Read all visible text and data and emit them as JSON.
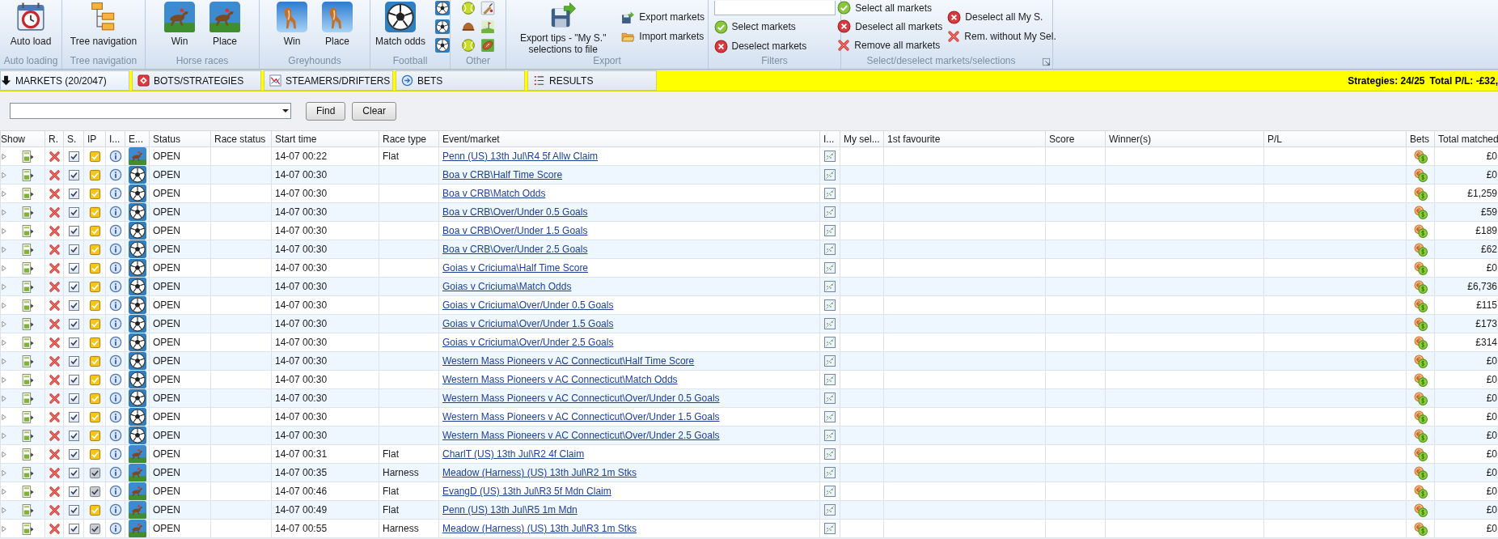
{
  "ribbon": {
    "groups": [
      {
        "label": "Auto loading",
        "buttons": [
          {
            "kind": "large",
            "label": "Auto load"
          }
        ]
      },
      {
        "label": "Tree navigation",
        "buttons": [
          {
            "kind": "large",
            "label": "Tree navigation"
          }
        ]
      },
      {
        "label": "Horse races",
        "buttons": [
          {
            "kind": "large",
            "label": "Win"
          },
          {
            "kind": "large",
            "label": "Place"
          }
        ]
      },
      {
        "label": "Greyhounds",
        "buttons": [
          {
            "kind": "large",
            "label": "Win"
          },
          {
            "kind": "large",
            "label": "Place"
          }
        ]
      },
      {
        "label": "Football",
        "buttons": [
          {
            "kind": "large",
            "label": "Match odds"
          },
          {
            "kind": "icon"
          },
          {
            "kind": "icon"
          },
          {
            "kind": "icon"
          }
        ]
      },
      {
        "label": "Other",
        "buttons": [
          {
            "kind": "icon"
          },
          {
            "kind": "icon"
          },
          {
            "kind": "icon"
          },
          {
            "kind": "icon"
          },
          {
            "kind": "icon"
          },
          {
            "kind": "icon"
          }
        ]
      },
      {
        "label": "Export",
        "buttons": [
          {
            "kind": "large",
            "label": "Export tips - \"My S.\" selections to file"
          },
          {
            "kind": "small",
            "label": "Export markets"
          },
          {
            "kind": "small",
            "label": "Import markets"
          }
        ]
      },
      {
        "label": "Filters",
        "buttons": [
          {
            "kind": "field"
          },
          {
            "kind": "small",
            "label": "Select markets"
          },
          {
            "kind": "small",
            "label": "Deselect markets"
          }
        ]
      },
      {
        "label": "Select/deselect markets/selections",
        "launcher": true,
        "buttons": [
          {
            "kind": "small",
            "label": "Select all markets"
          },
          {
            "kind": "small",
            "label": "Deselect all markets"
          },
          {
            "kind": "small",
            "label": "Remove all markets"
          },
          {
            "kind": "small",
            "label": "Deselect all My S."
          },
          {
            "kind": "small",
            "label": "Rem. without My Sel."
          }
        ]
      }
    ]
  },
  "tabs": [
    {
      "label": "MARKETS (20/2047)",
      "selected": true
    },
    {
      "label": "BOTS/STRATEGIES",
      "selected": false
    },
    {
      "label": "STEAMERS/DRIFTERS",
      "selected": false
    },
    {
      "label": "BETS",
      "selected": false
    },
    {
      "label": "RESULTS",
      "selected": false
    }
  ],
  "status_bar": {
    "strategies": "Strategies: 24/25",
    "total_pl": "Total P/L: -£32,"
  },
  "find_bar": {
    "buttons": [
      "Find",
      "Clear"
    ]
  },
  "table": {
    "columns": [
      "Show",
      "R.",
      "S.",
      "IP",
      "I...",
      "E...",
      "Status",
      "Race status",
      "Start time",
      "Race type",
      "Event/market",
      "I...",
      "My sel...",
      "1st favourite",
      "Score",
      "Winner(s)",
      "P/L",
      "Bets",
      "Total matched"
    ],
    "rows": [
      {
        "kind": "horse",
        "checked": true,
        "in_play": true,
        "status": "OPEN",
        "start_time": "14-07 00:22",
        "race_type": "Flat",
        "event": "Penn (US) 13th Jul\\R4 5f Allw Claim",
        "total_matched": "£0"
      },
      {
        "kind": "football",
        "checked": true,
        "in_play": true,
        "status": "OPEN",
        "start_time": "14-07 00:30",
        "event": "Boa v CRB\\Half Time Score",
        "total_matched": "£0"
      },
      {
        "kind": "football",
        "checked": true,
        "in_play": true,
        "status": "OPEN",
        "start_time": "14-07 00:30",
        "event": "Boa v CRB\\Match Odds",
        "total_matched": "£1,259"
      },
      {
        "kind": "football",
        "checked": true,
        "in_play": true,
        "status": "OPEN",
        "start_time": "14-07 00:30",
        "event": "Boa v CRB\\Over/Under 0.5 Goals",
        "total_matched": "£59"
      },
      {
        "kind": "football",
        "checked": true,
        "in_play": true,
        "status": "OPEN",
        "start_time": "14-07 00:30",
        "event": "Boa v CRB\\Over/Under 1.5 Goals",
        "total_matched": "£189"
      },
      {
        "kind": "football",
        "checked": true,
        "in_play": true,
        "status": "OPEN",
        "start_time": "14-07 00:30",
        "event": "Boa v CRB\\Over/Under 2.5 Goals",
        "total_matched": "£62"
      },
      {
        "kind": "football",
        "checked": true,
        "in_play": true,
        "status": "OPEN",
        "start_time": "14-07 00:30",
        "event": "Goias v Criciuma\\Half Time Score",
        "total_matched": "£0"
      },
      {
        "kind": "football",
        "checked": true,
        "in_play": true,
        "status": "OPEN",
        "start_time": "14-07 00:30",
        "event": "Goias v Criciuma\\Match Odds",
        "total_matched": "£6,736"
      },
      {
        "kind": "football",
        "checked": true,
        "in_play": true,
        "status": "OPEN",
        "start_time": "14-07 00:30",
        "event": "Goias v Criciuma\\Over/Under 0.5 Goals",
        "total_matched": "£115"
      },
      {
        "kind": "football",
        "checked": true,
        "in_play": true,
        "status": "OPEN",
        "start_time": "14-07 00:30",
        "event": "Goias v Criciuma\\Over/Under 1.5 Goals",
        "total_matched": "£173"
      },
      {
        "kind": "football",
        "checked": true,
        "in_play": true,
        "status": "OPEN",
        "start_time": "14-07 00:30",
        "event": "Goias v Criciuma\\Over/Under 2.5 Goals",
        "total_matched": "£314"
      },
      {
        "kind": "football",
        "checked": true,
        "in_play": true,
        "status": "OPEN",
        "start_time": "14-07 00:30",
        "event": "Western Mass Pioneers v AC Connecticut\\Half Time Score",
        "total_matched": "£0"
      },
      {
        "kind": "football",
        "checked": true,
        "in_play": true,
        "status": "OPEN",
        "start_time": "14-07 00:30",
        "event": "Western Mass Pioneers v AC Connecticut\\Match Odds",
        "total_matched": "£0"
      },
      {
        "kind": "football",
        "checked": true,
        "in_play": true,
        "status": "OPEN",
        "start_time": "14-07 00:30",
        "event": "Western Mass Pioneers v AC Connecticut\\Over/Under 0.5 Goals",
        "total_matched": "£0"
      },
      {
        "kind": "football",
        "checked": true,
        "in_play": true,
        "status": "OPEN",
        "start_time": "14-07 00:30",
        "event": "Western Mass Pioneers v AC Connecticut\\Over/Under 1.5 Goals",
        "total_matched": "£0"
      },
      {
        "kind": "football",
        "checked": true,
        "in_play": true,
        "status": "OPEN",
        "start_time": "14-07 00:30",
        "event": "Western Mass Pioneers v AC Connecticut\\Over/Under 2.5 Goals",
        "total_matched": "£0"
      },
      {
        "kind": "horse",
        "checked": true,
        "in_play": true,
        "status": "OPEN",
        "start_time": "14-07 00:31",
        "race_type": "Flat",
        "event": "CharlT (US) 13th Jul\\R2 4f Claim",
        "total_matched": "£0"
      },
      {
        "kind": "horse",
        "checked": true,
        "in_play": false,
        "status": "OPEN",
        "start_time": "14-07 00:35",
        "race_type": "Harness",
        "event": "Meadow (Harness) (US) 13th Jul\\R2 1m Stks",
        "total_matched": "£0"
      },
      {
        "kind": "horse",
        "checked": true,
        "in_play": false,
        "status": "OPEN",
        "start_time": "14-07 00:46",
        "race_type": "Flat",
        "event": "EvangD (US) 13th Jul\\R3 5f Mdn Claim",
        "total_matched": "£0"
      },
      {
        "kind": "horse",
        "checked": true,
        "in_play": true,
        "status": "OPEN",
        "start_time": "14-07 00:49",
        "race_type": "Flat",
        "event": "Penn (US) 13th Jul\\R5 1m Mdn",
        "total_matched": "£0"
      },
      {
        "kind": "horse",
        "checked": true,
        "in_play": false,
        "status": "OPEN",
        "start_time": "14-07 00:55",
        "race_type": "Harness",
        "event": "Meadow (Harness) (US) 13th Jul\\R3 1m Stks",
        "total_matched": "£0"
      }
    ]
  }
}
